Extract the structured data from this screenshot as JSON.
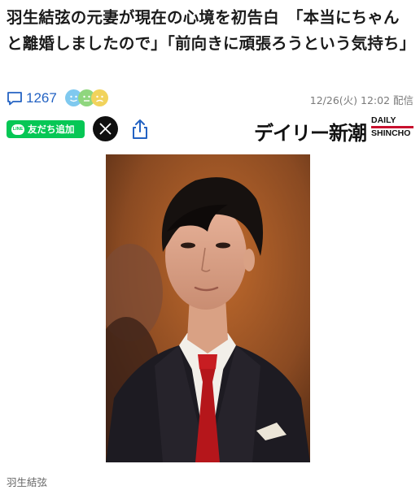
{
  "article": {
    "headline": "羽生結弦の元妻が現在の心境を初告白　「本当にちゃんと離婚しましたので」「前向きに頑張ろうという気持ち」",
    "comment_count": "1267",
    "timestamp": "12/26(火) 12:02 配信",
    "caption": "羽生結弦"
  },
  "share": {
    "line_label": "友だち追加",
    "line_logo": "LINE"
  },
  "publisher": {
    "name_ja": "デイリー新潮",
    "name_en_top": "DAILY",
    "name_en_bottom": "SHINCHO"
  },
  "icons": {
    "comment": "comment-icon",
    "reactions": "reaction-faces-icon",
    "line": "line-icon",
    "x": "x-icon",
    "share": "share-icon"
  },
  "colors": {
    "link": "#2463c3",
    "line_green": "#06c755",
    "brand_red": "#c8102e"
  }
}
